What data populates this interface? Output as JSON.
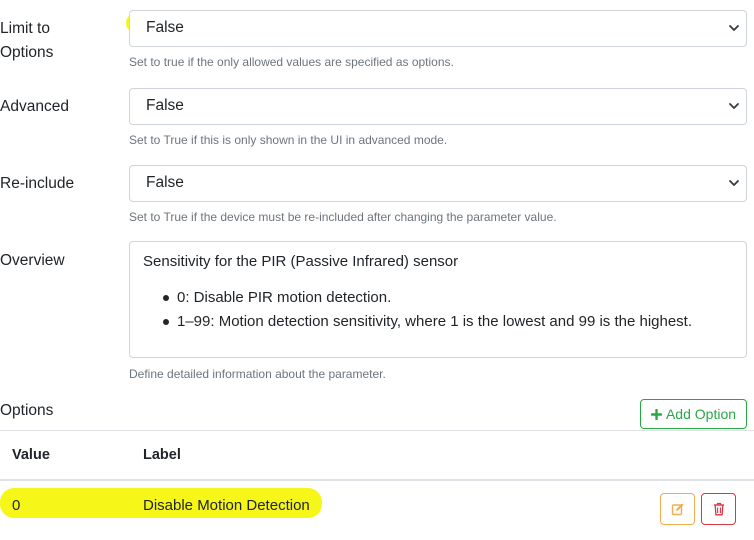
{
  "fields": {
    "limit_to_options": {
      "label_line1": "Limit to",
      "label_line2": "Options",
      "value": "False",
      "help": "Set to true if the only allowed values are specified as options."
    },
    "advanced": {
      "label": "Advanced",
      "value": "False",
      "help": "Set to True if this is only shown in the UI in advanced mode."
    },
    "reinclude": {
      "label": "Re-include",
      "value": "False",
      "help": "Set to True if the device must be re-included after changing the parameter value."
    },
    "overview": {
      "label": "Overview",
      "heading": "Sensitivity for the PIR (Passive Infrared) sensor",
      "bullets": [
        "0: Disable PIR motion detection.",
        "1–99: Motion detection sensitivity, where 1 is the lowest and 99 is the highest."
      ],
      "help": "Define detailed information about the parameter."
    }
  },
  "options": {
    "label": "Options",
    "add_button": "Add Option",
    "columns": [
      "Value",
      "Label"
    ],
    "rows": [
      {
        "value": "0",
        "label": "Disable Motion Detection"
      }
    ]
  },
  "colors": {
    "success": "#28a745",
    "warning": "#f0ad4e",
    "danger": "#dc3545",
    "highlight": "#f5f500"
  }
}
